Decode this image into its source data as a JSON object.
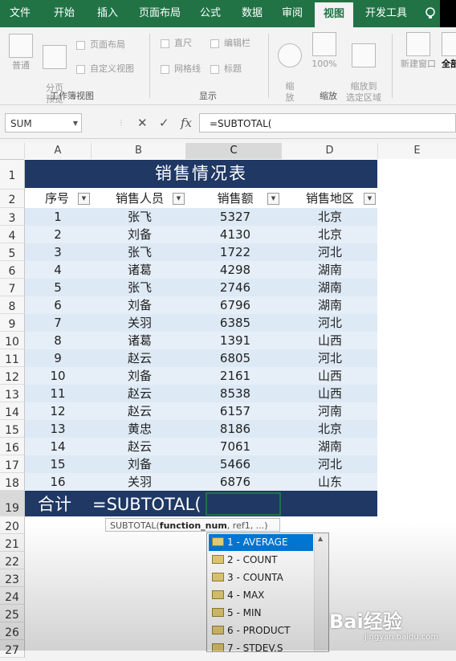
{
  "ribbon_tabs": [
    "文件",
    "开始",
    "插入",
    "页面布局",
    "公式",
    "数据",
    "审阅",
    "视图",
    "开发工具"
  ],
  "ribbon": {
    "workbook_views": {
      "normal": "普通",
      "page_break": "分页\n预览",
      "page_layout": "页面布局",
      "custom_views": "自定义视图",
      "group_label": "工作簿视图"
    },
    "show": {
      "ruler": "直尺",
      "formula_bar": "编辑栏",
      "gridlines": "网格线",
      "headings": "标题",
      "group_label": "显示"
    },
    "zoom": {
      "zoom": "缩\n放",
      "zoom100": "100%",
      "zoom_selection": "缩放到\n选定区域",
      "group_label": "缩放"
    },
    "window": {
      "new_window": "新建窗口",
      "arrange_all": "全部"
    }
  },
  "formula_bar": {
    "name_box": "SUM",
    "formula": "=SUBTOTAL("
  },
  "columns": [
    "A",
    "B",
    "C",
    "D",
    "E"
  ],
  "row_numbers": [
    "1",
    "2",
    "3",
    "4",
    "5",
    "6",
    "7",
    "8",
    "9",
    "10",
    "11",
    "12",
    "13",
    "14",
    "15",
    "16",
    "17",
    "18",
    "19",
    "20",
    "21",
    "22",
    "23",
    "24",
    "25",
    "26",
    "27"
  ],
  "sheet": {
    "title": "销售情况表",
    "headers": [
      "序号",
      "销售人员",
      "销售额",
      "销售地区"
    ],
    "rows": [
      [
        "1",
        "张飞",
        "5327",
        "北京"
      ],
      [
        "2",
        "刘备",
        "4130",
        "北京"
      ],
      [
        "3",
        "张飞",
        "1722",
        "河北"
      ],
      [
        "4",
        "诸葛",
        "4298",
        "湖南"
      ],
      [
        "5",
        "张飞",
        "2746",
        "湖南"
      ],
      [
        "6",
        "刘备",
        "6796",
        "湖南"
      ],
      [
        "7",
        "关羽",
        "6385",
        "河北"
      ],
      [
        "8",
        "诸葛",
        "1391",
        "山西"
      ],
      [
        "9",
        "赵云",
        "6805",
        "河北"
      ],
      [
        "10",
        "刘备",
        "2161",
        "山西"
      ],
      [
        "11",
        "赵云",
        "8538",
        "山西"
      ],
      [
        "12",
        "赵云",
        "6157",
        "河南"
      ],
      [
        "13",
        "黄忠",
        "8186",
        "北京"
      ],
      [
        "14",
        "赵云",
        "7061",
        "湖南"
      ],
      [
        "15",
        "刘备",
        "5466",
        "河北"
      ],
      [
        "16",
        "关羽",
        "6876",
        "山东"
      ]
    ],
    "total_label": "合计",
    "total_formula": "=SUBTOTAL("
  },
  "tooltip": {
    "fn": "SUBTOTAL(",
    "arg1": "function_num",
    "rest": ", ref1, ...)"
  },
  "autocomplete": [
    "1 - AVERAGE",
    "2 - COUNT",
    "3 - COUNTA",
    "4 - MAX",
    "5 - MIN",
    "6 - PRODUCT",
    "7 - STDEV.S"
  ],
  "watermark": {
    "logo": "Bai经验",
    "url": "jingyan.baidu.com"
  },
  "colors": {
    "excel_green": "#217346",
    "title_fill": "#1f3864",
    "band_fill": "#dde9f5",
    "selection_blue": "#0078d7"
  }
}
